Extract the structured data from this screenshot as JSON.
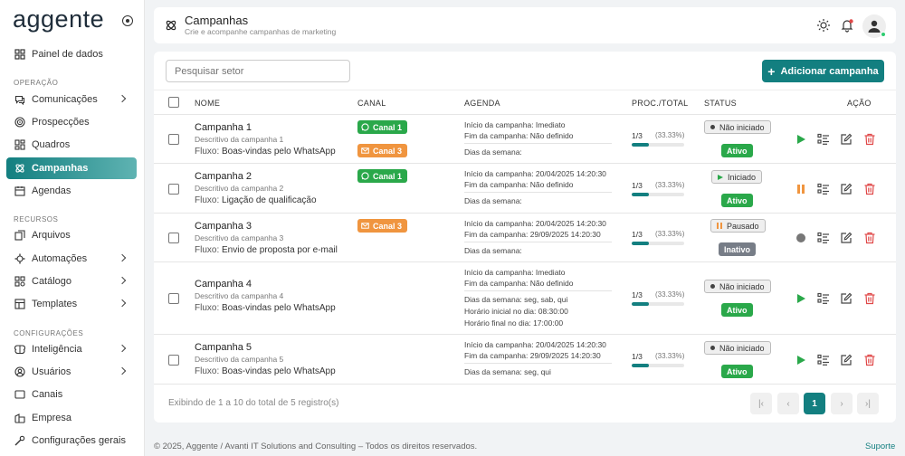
{
  "brand": {
    "logo": "aggente"
  },
  "sidebar": {
    "dashboard": "Painel de dados",
    "sections": {
      "operacao": "OPERAÇÃO",
      "recursos": "RECURSOS",
      "configuracoes": "CONFIGURAÇÕES"
    },
    "items": [
      {
        "label": "Comunicações",
        "icon": "chat-icon",
        "chevron": true
      },
      {
        "label": "Prospecções",
        "icon": "target-icon",
        "chevron": false
      },
      {
        "label": "Quadros",
        "icon": "kanban-icon",
        "chevron": false
      },
      {
        "label": "Campanhas",
        "icon": "campaign-icon",
        "chevron": false,
        "active": true
      },
      {
        "label": "Agendas",
        "icon": "calendar-icon",
        "chevron": false
      },
      {
        "label": "Arquivos",
        "icon": "files-icon",
        "chevron": false
      },
      {
        "label": "Automações",
        "icon": "automation-icon",
        "chevron": true
      },
      {
        "label": "Catálogo",
        "icon": "catalog-icon",
        "chevron": true
      },
      {
        "label": "Templates",
        "icon": "templates-icon",
        "chevron": true
      },
      {
        "label": "Inteligência",
        "icon": "brain-icon",
        "chevron": true
      },
      {
        "label": "Usuários",
        "icon": "users-icon",
        "chevron": true
      },
      {
        "label": "Canais",
        "icon": "channels-icon",
        "chevron": false
      },
      {
        "label": "Empresa",
        "icon": "company-icon",
        "chevron": false
      },
      {
        "label": "Configurações gerais",
        "icon": "settings-icon",
        "chevron": false
      }
    ]
  },
  "header": {
    "title": "Campanhas",
    "subtitle": "Crie e acompanhe campanhas de marketing"
  },
  "toolbar": {
    "search_placeholder": "Pesquisar setor",
    "add_label": "Adicionar campanha"
  },
  "table": {
    "columns": {
      "nome": "NOME",
      "canal": "CANAL",
      "agenda": "AGENDA",
      "proc": "PROC./TOTAL",
      "status": "STATUS",
      "acao": "AÇÃO"
    },
    "flow_prefix": "Fluxo:",
    "rows": [
      {
        "name": "Campanha 1",
        "desc": "Descritivo da campanha 1",
        "flow": "Boas-vindas pelo WhatsApp",
        "channels": [
          {
            "label": "Canal 1",
            "type": "whatsapp"
          },
          {
            "label": "Canal 3",
            "type": "email"
          }
        ],
        "agenda": {
          "start_label": "Início da campanha:",
          "start": "Imediato",
          "end_label": "Fim da campanha:",
          "end": "Não definido",
          "days_label": "Dias da semana:",
          "days": "",
          "hstart_label": "",
          "hstart": "",
          "hend_label": "",
          "hend": ""
        },
        "proc": "1/3",
        "pct": "(33.33%)",
        "progress": 0.3333,
        "status": "Não iniciado",
        "status_kind": "not-started",
        "active": "Ativo",
        "active_kind": "on",
        "primary_action": "play"
      },
      {
        "name": "Campanha 2",
        "desc": "Descritivo da campanha 2",
        "flow": "Ligação de qualificação",
        "channels": [
          {
            "label": "Canal 1",
            "type": "whatsapp"
          }
        ],
        "agenda": {
          "start_label": "Início da campanha:",
          "start": "20/04/2025 14:20:30",
          "end_label": "Fim da campanha:",
          "end": "Não definido",
          "days_label": "Dias da semana:",
          "days": "",
          "hstart_label": "",
          "hstart": "",
          "hend_label": "",
          "hend": ""
        },
        "proc": "1/3",
        "pct": "(33.33%)",
        "progress": 0.3333,
        "status": "Iniciado",
        "status_kind": "started",
        "active": "Ativo",
        "active_kind": "on",
        "primary_action": "pause"
      },
      {
        "name": "Campanha 3",
        "desc": "Descritivo da campanha 3",
        "flow": "Envio de proposta por e-mail",
        "channels": [
          {
            "label": "Canal 3",
            "type": "email"
          }
        ],
        "agenda": {
          "start_label": "Início da campanha:",
          "start": "20/04/2025 14:20:30",
          "end_label": "Fim da campanha:",
          "end": "29/09/2025 14:20:30",
          "days_label": "Dias da semana:",
          "days": "",
          "hstart_label": "",
          "hstart": "",
          "hend_label": "",
          "hend": ""
        },
        "proc": "1/3",
        "pct": "(33.33%)",
        "progress": 0.3333,
        "status": "Pausado",
        "status_kind": "paused",
        "active": "Inativo",
        "active_kind": "off",
        "primary_action": "disabled"
      },
      {
        "name": "Campanha 4",
        "desc": "Descritivo da campanha 4",
        "flow": "Boas-vindas pelo WhatsApp",
        "channels": [],
        "agenda": {
          "start_label": "Início da campanha:",
          "start": "Imediato",
          "end_label": "Fim da campanha:",
          "end": "Não definido",
          "days_label": "Dias da semana:",
          "days": "seg, sab, qui",
          "hstart_label": "Horário inicial no dia:",
          "hstart": "08:30:00",
          "hend_label": "Horário final no dia:",
          "hend": "17:00:00"
        },
        "proc": "1/3",
        "pct": "(33.33%)",
        "progress": 0.3333,
        "status": "Não iniciado",
        "status_kind": "not-started",
        "active": "Ativo",
        "active_kind": "on",
        "primary_action": "play"
      },
      {
        "name": "Campanha 5",
        "desc": "Descritivo da campanha 5",
        "flow": "Boas-vindas pelo WhatsApp",
        "channels": [],
        "agenda": {
          "start_label": "Início da campanha:",
          "start": "20/04/2025 14:20:30",
          "end_label": "Fim da campanha:",
          "end": "29/09/2025 14:20:30",
          "days_label": "Dias da semana:",
          "days": "seg, qui",
          "hstart_label": "",
          "hstart": "",
          "hend_label": "",
          "hend": ""
        },
        "proc": "1/3",
        "pct": "(33.33%)",
        "progress": 0.3333,
        "status": "Não iniciado",
        "status_kind": "not-started",
        "active": "Ativo",
        "active_kind": "on",
        "primary_action": "play"
      }
    ]
  },
  "pagination": {
    "info": "Exibindo de 1 a 10 do total de 5 registro(s)",
    "current_page": "1"
  },
  "footer": {
    "copyright": "© 2025, Aggente / Avanti IT Solutions and Consulting – Todos os direitos reservados.",
    "support": "Suporte"
  },
  "colors": {
    "accent": "#137f80",
    "whatsapp": "#2aa84a",
    "email": "#f0953f",
    "danger": "#e04848",
    "inactive": "#777d87"
  }
}
